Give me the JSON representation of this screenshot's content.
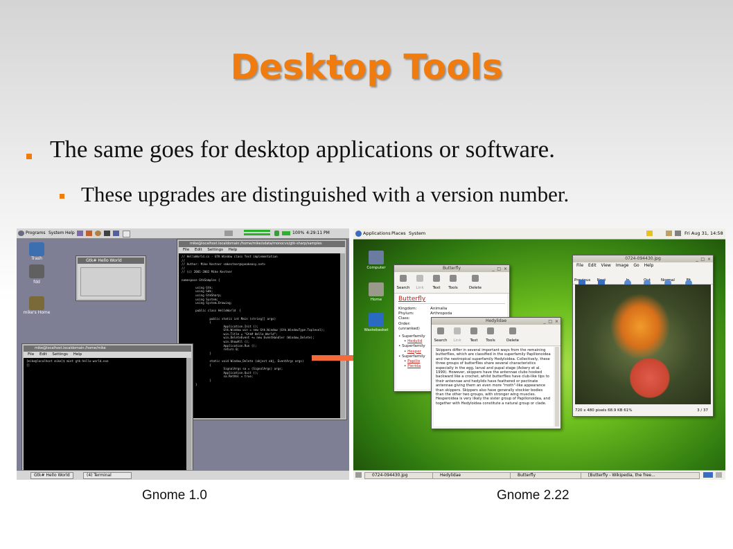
{
  "slide": {
    "title": "Desktop Tools",
    "bullet1": "The same goes for desktop applications or software.",
    "bullet2": "These upgrades are distinguished with a version number.",
    "caption_left": "Gnome 1.0",
    "caption_right": "Gnome 2.22",
    "accent_color": "#f07c10"
  },
  "gnome1": {
    "panel": {
      "programs": "Programs",
      "system": "System",
      "help": "Help",
      "battery": "100%",
      "clock": "4:29:11 PM"
    },
    "desktop_icons": [
      "Trash",
      "fdd",
      "mike's Home"
    ],
    "hello_window_title": "Gtk# Hello World",
    "editor": {
      "title": "mike@localhost.localdomain:/home/mike/sdata/monocvs/gtk-sharp/samples",
      "menu": [
        "File",
        "Edit",
        "Settings",
        "Help"
      ],
      "code": "// HelloWorld.cs - GTK Window class Test implementation\n//\n// Author: Mike Kestner <mkestner@speakeasy.net>\n//\n// (c) 2001-2002 Mike Kestner\n\nnamespace GtkSamples {\n\n        using Gtk;\n        using Gdk;\n        using GtkSharp;\n        using System;\n        using System.Drawing;\n\n        public class HelloWorld  {\n\n                public static int Main (string[] args)\n                {\n                        Application.Init ();\n                        Gtk.Window win = new Gtk.Window (Gtk.WindowType.Toplevel);\n                        win.Title = \"Gtk# Hello World\";\n                        win.DeleteEvent += new EventHandler (Window_Delete);\n                        win.ShowAll ();\n                        Application.Run ();\n                        return 0;\n                }\n\n                static void Window_Delete (object obj, EventArgs args)\n                {\n                        SignalArgs sa = (SignalArgs) args;\n                        Application.Quit ();\n                        sa.RetVal = true;\n                }\n        }\n}"
    },
    "terminal": {
      "title": "mike@localhost.localdomain:/home/mike",
      "menu": [
        "File",
        "Edit",
        "Settings",
        "Help"
      ],
      "text": "[mike@localhost mike]$ mint gtk-hello-world.exe\n[]"
    },
    "taskbar": [
      "Gtk# Hello World",
      "(4) Terminal"
    ]
  },
  "gnome2": {
    "panel": {
      "applications": "Applications",
      "places": "Places",
      "system": "System",
      "clock": "Fri Aug 31, 14:58"
    },
    "desktop_icons": [
      "Computer",
      "Home",
      "Wastebasket"
    ],
    "eog": {
      "title": "0724-094430.jpg",
      "menu": [
        "File",
        "Edit",
        "View",
        "Image",
        "Go",
        "Help"
      ],
      "tools": [
        "Previous",
        "Next",
        "In",
        "Out",
        "Normal",
        "Fit"
      ],
      "status_left": "720 x 480 pixels 68.9 KB 61%",
      "status_right": "3 / 37"
    },
    "butterfly": {
      "title": "Butterfly",
      "tools": [
        "Search",
        "Link",
        "Text",
        "Tools",
        "Delete"
      ],
      "heading": "Butterfly",
      "rows": [
        {
          "label": "Kingdom:",
          "value": "Animalia"
        },
        {
          "label": "Phylum:",
          "value": "Arthropoda"
        },
        {
          "label": "Class:",
          "value": ""
        },
        {
          "label": "Order:",
          "value": ""
        },
        {
          "label": "(unranked)",
          "value": ""
        }
      ],
      "list": [
        "Superfamily",
        "Hedylid",
        "Superfamily",
        "Hesper",
        "Superfamily",
        "Papilio",
        "Pierida"
      ]
    },
    "hedylidae": {
      "title": "Hedylidae",
      "tools": [
        "Search",
        "Link",
        "Text",
        "Tools",
        "Delete"
      ],
      "text": "Skippers differ in several important ways from the remaining butterflies, which are classified in the superfamily Papilionoidea and the neotropical superfamily Hedyloidea. Collectively, these three groups of butterflies share several characteristics especially in the egg, larval and pupal stage (Ackery et al. 1999). However, skippers have the antennae clubs hooked backward like a crochet, whilst butterflies have club-like tips to their antennae and hedylids have feathered or pectinate antennae giving them an even more \"moth\"-like appearance than skippers. Skippers also have generally stockier bodies than the other two groups, with stronger wing muscles. Hesperoidea is very likely the sister group of Papilionoidea, and together with Hedyloidea constitute a natural group or clade."
    },
    "taskbar": [
      "0724-094430.jpg",
      "Hedylidae",
      "Butterfly",
      "[Butterfly - Wikipedia, the free..."
    ]
  }
}
